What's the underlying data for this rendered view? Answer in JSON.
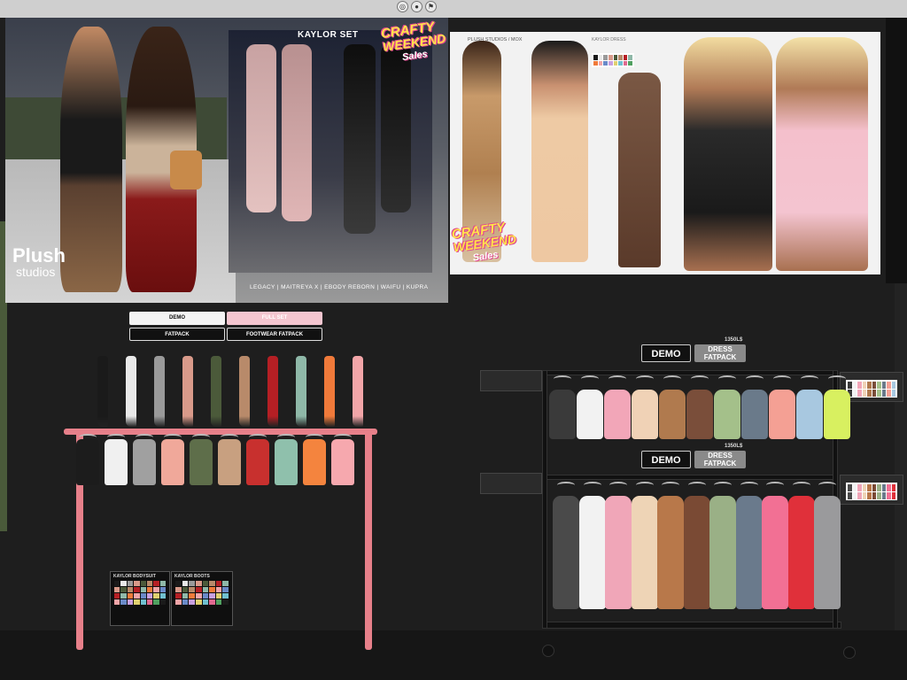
{
  "hud": {
    "icons": [
      "zoom-icon",
      "camera-icon",
      "flag-icon"
    ]
  },
  "poster_left": {
    "logo_line1": "Plush",
    "logo_line2": "studios",
    "set_title": "KAYLOR SET",
    "brands": "LEGACY | MAITREYA X | EBODY REBORN | WAIFU | KUPRA",
    "crafty_line1": "CRAFTY",
    "crafty_line2": "WEEKEND",
    "crafty_line3": "Sales"
  },
  "poster_right": {
    "brand": "PLUSH STUDIOS / MOX",
    "label": "KAYLOR DRESS",
    "crafty_line1": "CRAFTY",
    "crafty_line2": "WEEKEND",
    "crafty_line3": "Sales"
  },
  "left_buttons": {
    "demo": "DEMO",
    "fullset": "FULL SET",
    "fatpack": "FATPACK",
    "footwear": "FOOTWEAR FATPACK"
  },
  "right_buttons": {
    "demo_top": "DEMO",
    "fatpack_top": "DRESS FATPACK",
    "price_top": "1350L$",
    "demo_bottom": "DEMO",
    "fatpack_bottom": "DRESS FATPACK",
    "price_bottom": "1350L$"
  },
  "palettes": {
    "bodysuit": "KAYLOR BODYSUIT",
    "boots": "KAYLOR BOOTS"
  },
  "colors": {
    "boots": [
      "#1a1a1a",
      "#e9e9e9",
      "#9a9a9a",
      "#d99a8a",
      "#4b5a3a",
      "#b88a6a",
      "#b51f24",
      "#8fb8a8",
      "#f07a3a",
      "#f2a5a8"
    ],
    "suits": [
      "#1c1c1c",
      "#f0f0f0",
      "#a0a0a0",
      "#f0a89a",
      "#5e6e4a",
      "#c8a080",
      "#c8302e",
      "#8fc0ac",
      "#f4843e",
      "#f6a8ae"
    ],
    "dresses_top": [
      "#3a3a3a",
      "#f2f2f2",
      "#f2a6b8",
      "#f0d2b6",
      "#b07a4e",
      "#7a4e3a",
      "#a4c08a",
      "#6a7a8a",
      "#f4a094",
      "#a8c8e0",
      "#d8f060"
    ],
    "dresses_bottom": [
      "#4a4a4a",
      "#f2f2f2",
      "#f0a6b8",
      "#eed4b6",
      "#b8784a",
      "#7a4a34",
      "#9ab086",
      "#6a7a8c",
      "#f27094",
      "#e0303a",
      "#9a9a9c"
    ],
    "palette_grid": [
      "#1a1a1a",
      "#e9e9e9",
      "#9a9a9a",
      "#d99a8a",
      "#4b5a3a",
      "#b88a6a",
      "#b51f24",
      "#8fb8a8",
      "#f07a3a",
      "#f2a5a8",
      "#6a8ac8",
      "#c8a0e0",
      "#e0d070",
      "#70c0d0",
      "#e06a90",
      "#50a060"
    ]
  }
}
